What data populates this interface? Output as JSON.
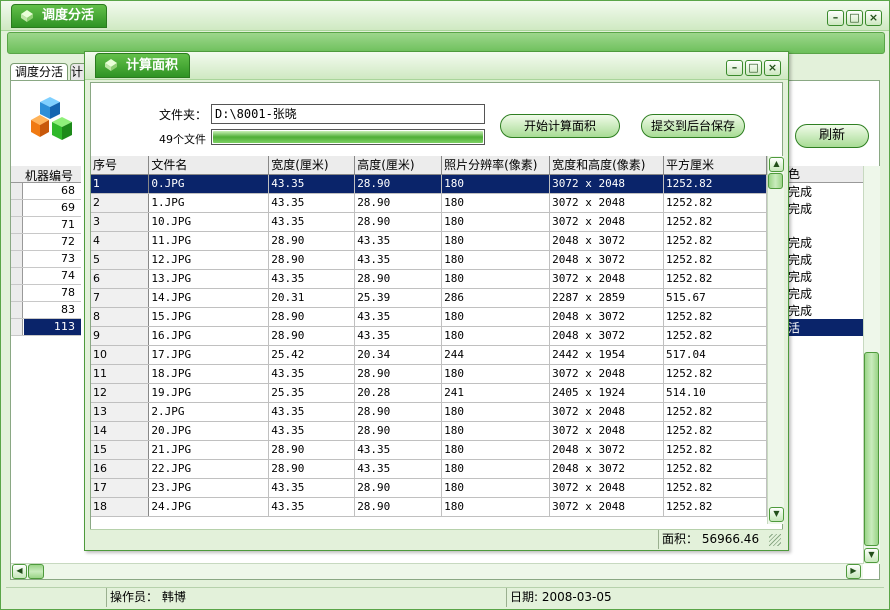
{
  "main_window": {
    "title": "调度分活",
    "tabs": [
      "调度分活",
      "计"
    ],
    "refresh_label": "刷新",
    "grid_header": "机器编号",
    "right_header": "色",
    "rows": [
      {
        "num": "68",
        "right": "完成"
      },
      {
        "num": "69",
        "right": "完成"
      },
      {
        "num": "71",
        "right": ""
      },
      {
        "num": "72",
        "right": "完成"
      },
      {
        "num": "73",
        "right": "完成"
      },
      {
        "num": "74",
        "right": "完成"
      },
      {
        "num": "78",
        "right": "完成"
      },
      {
        "num": "83",
        "right": "完成"
      },
      {
        "num": "113",
        "right": "活"
      }
    ],
    "status": {
      "operator": "操作员：  韩博",
      "date": "日期:  2008-03-05"
    }
  },
  "window_buttons": {
    "minimize": "–",
    "maximize": "□",
    "close": "×"
  },
  "dialog": {
    "title": "计算面积",
    "folder_label": "文件夹：",
    "folder_value": "D:\\8001-张晓",
    "file_count": "49个文件",
    "progress": 1.0,
    "calc_button": "开始计算面积",
    "submit_button": "提交到后台保存",
    "columns": [
      "序号",
      "文件名",
      "宽度(厘米)",
      "高度(厘米)",
      "照片分辨率(像素)",
      "宽度和高度(像素)",
      "平方厘米"
    ],
    "rows": [
      [
        "1",
        "0.JPG",
        "43.35",
        "28.90",
        "180",
        "3072 x 2048",
        "1252.82"
      ],
      [
        "2",
        "1.JPG",
        "43.35",
        "28.90",
        "180",
        "3072 x 2048",
        "1252.82"
      ],
      [
        "3",
        "10.JPG",
        "43.35",
        "28.90",
        "180",
        "3072 x 2048",
        "1252.82"
      ],
      [
        "4",
        "11.JPG",
        "28.90",
        "43.35",
        "180",
        "2048 x 3072",
        "1252.82"
      ],
      [
        "5",
        "12.JPG",
        "28.90",
        "43.35",
        "180",
        "2048 x 3072",
        "1252.82"
      ],
      [
        "6",
        "13.JPG",
        "43.35",
        "28.90",
        "180",
        "3072 x 2048",
        "1252.82"
      ],
      [
        "7",
        "14.JPG",
        "20.31",
        "25.39",
        "286",
        "2287 x 2859",
        "515.67"
      ],
      [
        "8",
        "15.JPG",
        "28.90",
        "43.35",
        "180",
        "2048 x 3072",
        "1252.82"
      ],
      [
        "9",
        "16.JPG",
        "28.90",
        "43.35",
        "180",
        "2048 x 3072",
        "1252.82"
      ],
      [
        "10",
        "17.JPG",
        "25.42",
        "20.34",
        "244",
        "2442 x 1954",
        "517.04"
      ],
      [
        "11",
        "18.JPG",
        "43.35",
        "28.90",
        "180",
        "3072 x 2048",
        "1252.82"
      ],
      [
        "12",
        "19.JPG",
        "25.35",
        "20.28",
        "241",
        "2405 x 1924",
        "514.10"
      ],
      [
        "13",
        "2.JPG",
        "43.35",
        "28.90",
        "180",
        "3072 x 2048",
        "1252.82"
      ],
      [
        "14",
        "20.JPG",
        "43.35",
        "28.90",
        "180",
        "3072 x 2048",
        "1252.82"
      ],
      [
        "15",
        "21.JPG",
        "28.90",
        "43.35",
        "180",
        "2048 x 3072",
        "1252.82"
      ],
      [
        "16",
        "22.JPG",
        "28.90",
        "43.35",
        "180",
        "2048 x 3072",
        "1252.82"
      ],
      [
        "17",
        "23.JPG",
        "43.35",
        "28.90",
        "180",
        "3072 x 2048",
        "1252.82"
      ],
      [
        "18",
        "24.JPG",
        "43.35",
        "28.90",
        "180",
        "3072 x 2048",
        "1252.82"
      ]
    ],
    "selected_row": 0,
    "total_area": "面积：  56966.46"
  }
}
